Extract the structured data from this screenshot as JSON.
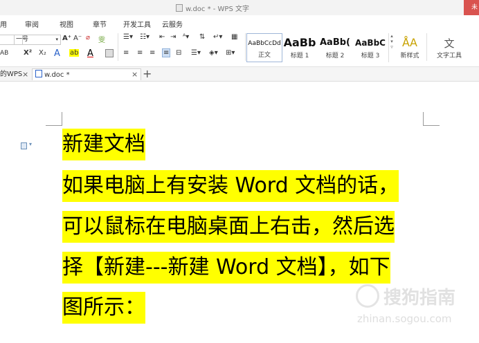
{
  "window": {
    "title": "w.doc * - WPS 文字",
    "corner_label": "未"
  },
  "menu": [
    "用",
    "审阅",
    "视图",
    "章节",
    "开发工具",
    "云服务"
  ],
  "ribbon": {
    "font_size_value": "一号",
    "increase_font": "A⁺",
    "decrease_font": "A⁻",
    "phonetic": "雯",
    "char_border": "AB",
    "superscript": "X²",
    "subscript": "X₂",
    "text_effect": "A",
    "highlight": "ab",
    "font_color": "A",
    "styles": [
      {
        "sample": "AaBbCcDd",
        "label": "正文"
      },
      {
        "sample": "AaBb",
        "label": "标题 1"
      },
      {
        "sample": "AaBb(",
        "label": "标题 2"
      },
      {
        "sample": "AaBbC",
        "label": "标题 3"
      }
    ],
    "new_style_label": "新样式",
    "text_tools_label": "文字工具"
  },
  "tabs": {
    "first_partial": "的WPS",
    "active": "w.doc *",
    "add": "+"
  },
  "document": {
    "lines": [
      "新建文档",
      "如果电脑上有安装 Word 文档的话，",
      "可以鼠标在电脑桌面上右击，然后选",
      "择【新建---新建 Word 文档】，如下",
      "图所示："
    ],
    "highlight_color": "#ffff00"
  },
  "watermark": {
    "brand": "搜狗指南",
    "url": "zhinan.sogou.com"
  }
}
